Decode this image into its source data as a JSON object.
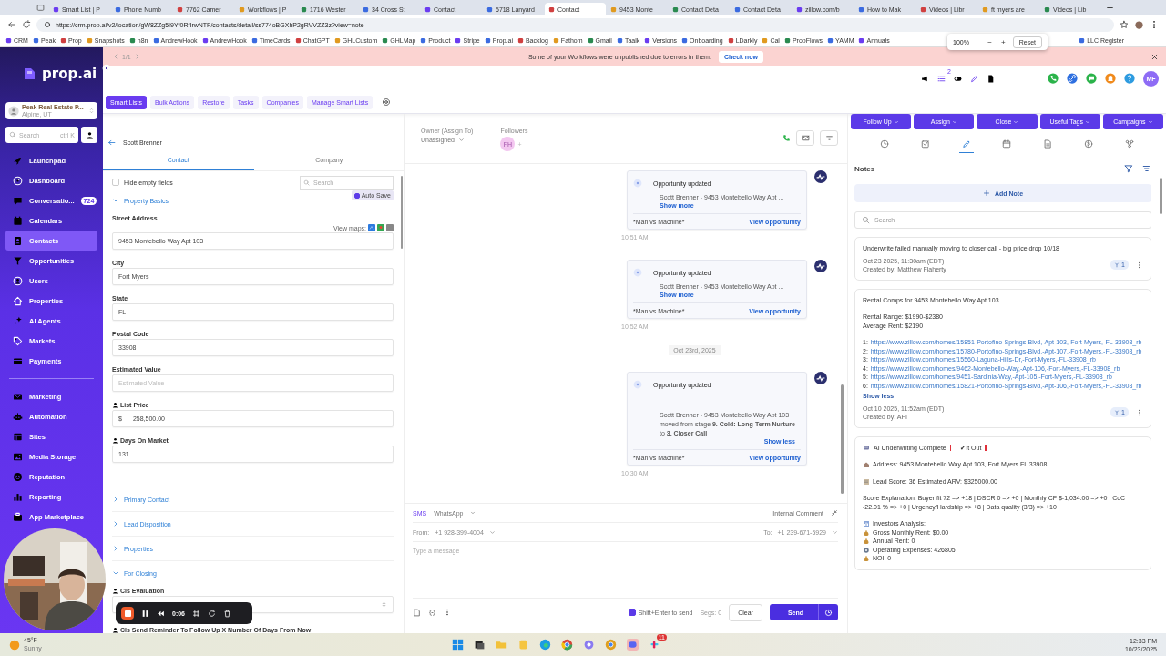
{
  "browser": {
    "tabs": [
      {
        "title": "Smart List | P",
        "selected": false
      },
      {
        "title": "Phone Numb",
        "selected": false
      },
      {
        "title": "7762 Camer",
        "selected": false
      },
      {
        "title": "Workflows | P",
        "selected": false
      },
      {
        "title": "1716 Wester",
        "selected": false
      },
      {
        "title": "34 Cross St",
        "selected": false
      },
      {
        "title": "Contact",
        "selected": false
      },
      {
        "title": "5718 Lanyard",
        "selected": false
      },
      {
        "title": "Contact",
        "selected": true
      },
      {
        "title": "9453 Monte",
        "selected": false
      },
      {
        "title": "Contact Deta",
        "selected": false
      },
      {
        "title": "Contact Deta",
        "selected": false
      },
      {
        "title": "zillow.com/b",
        "selected": false
      },
      {
        "title": "How to Mak",
        "selected": false
      },
      {
        "title": "Videos | Libr",
        "selected": false
      },
      {
        "title": "ft myers are",
        "selected": false
      },
      {
        "title": "Videos | Lib",
        "selected": false
      }
    ],
    "url": "https://crm.prop.ai/v2/location/gW8ZZg5I9Yf0RfIrwNTF/contacts/detail/ss774oBGXhP2gRVVZZ3z?view=note",
    "bookmarks": [
      "CRM",
      "Peak",
      "Prop",
      "Snapshots",
      "n8n",
      "AndrewHook",
      "AndrewHook",
      "TimeCards",
      "ChatGPT",
      "GHLCustom",
      "GHLMap",
      "Product",
      "Stripe",
      "Prop.ai",
      "Backlog",
      "Fathom",
      "Gmail",
      "Taalk",
      "Versions",
      "Onboarding",
      "LDarkly",
      "Cal",
      "PropFlows",
      "YAMM",
      "Annuals",
      "LLC Register"
    ],
    "zoom": {
      "value": "100%",
      "minus": "−",
      "plus": "+",
      "reset": "Reset"
    }
  },
  "banner": {
    "pager": "1/1",
    "message": "Some of your Workflows were unpublished due to errors in them.",
    "action": "Check now"
  },
  "header": {
    "badge": "2",
    "avatar": "MF"
  },
  "sidebar": {
    "logo": "prop.ai",
    "account": {
      "name": "Peak Real Estate P...",
      "location": "Alpine, UT"
    },
    "search": {
      "placeholder": "Search",
      "shortcut": "ctrl K"
    },
    "groups": [
      [
        {
          "label": "Launchpad",
          "selected": false
        },
        {
          "label": "Dashboard",
          "selected": false
        },
        {
          "label": "Conversatio...",
          "badge": "724",
          "selected": false
        },
        {
          "label": "Calendars",
          "selected": false
        },
        {
          "label": "Contacts",
          "selected": true
        },
        {
          "label": "Opportunities",
          "selected": false
        },
        {
          "label": "Users",
          "selected": false
        },
        {
          "label": "Properties",
          "selected": false
        },
        {
          "label": "AI Agents",
          "selected": false
        },
        {
          "label": "Markets",
          "selected": false
        },
        {
          "label": "Payments",
          "selected": false
        }
      ],
      [
        {
          "label": "Marketing",
          "selected": false
        },
        {
          "label": "Automation",
          "selected": false
        },
        {
          "label": "Sites",
          "selected": false
        },
        {
          "label": "Media Storage",
          "selected": false
        },
        {
          "label": "Reputation",
          "selected": false
        },
        {
          "label": "Reporting",
          "selected": false
        },
        {
          "label": "App Marketplace",
          "selected": false
        }
      ]
    ]
  },
  "toolbar": {
    "tabs": [
      {
        "label": "Smart Lists",
        "selected": true
      },
      {
        "label": "Bulk Actions",
        "selected": false
      },
      {
        "label": "Restore",
        "selected": false
      },
      {
        "label": "Tasks",
        "selected": false
      },
      {
        "label": "Companies",
        "selected": false
      },
      {
        "label": "Manage Smart Lists",
        "selected": false
      }
    ]
  },
  "contact": {
    "name": "Scott Brenner",
    "tabs": [
      {
        "label": "Contact",
        "selected": true
      },
      {
        "label": "Company",
        "selected": false
      }
    ],
    "hide_empty": {
      "label": "Hide empty fields",
      "checked": false
    },
    "search": {
      "placeholder": "Search"
    },
    "auto_save": {
      "label": "Auto Save",
      "checked": true
    },
    "sections": [
      {
        "title": "Property Basics",
        "expanded": true,
        "fields": [
          {
            "kind": "input",
            "label": "Street Address",
            "value": "9453 Montebello Way Apt 103",
            "maps_label": "View maps:",
            "custom": false
          },
          {
            "kind": "input",
            "label": "City",
            "value": "Fort Myers",
            "custom": false
          },
          {
            "kind": "input",
            "label": "State",
            "value": "FL",
            "custom": false
          },
          {
            "kind": "input",
            "label": "Postal Code",
            "value": "33908",
            "custom": false
          },
          {
            "kind": "input",
            "label": "Estimated Value",
            "placeholder": "Estimated Value",
            "custom": false
          },
          {
            "kind": "input",
            "label": "List Price",
            "prefix": "$",
            "value": "258,500.00",
            "custom": true
          },
          {
            "kind": "input",
            "label": "Days On Market",
            "value": "131",
            "custom": true
          }
        ]
      },
      {
        "title": "Primary Contact",
        "expanded": false
      },
      {
        "title": "Lead Disposition",
        "expanded": false
      },
      {
        "title": "Properties",
        "expanded": false
      },
      {
        "title": "For Closing",
        "expanded": true,
        "fields": [
          {
            "kind": "select",
            "label": "Cls Evaluation",
            "custom": true
          },
          {
            "kind": "heading",
            "label": "Cls Send Reminder To Follow Up X Number Of Days From Now",
            "custom": true
          }
        ]
      }
    ]
  },
  "conversation": {
    "owner_label": "Owner (Assign To)",
    "owner_value": "Unassigned",
    "followers_label": "Followers",
    "follower": "FH",
    "add_follower": "+",
    "messages": [
      {
        "kind": "card",
        "title": "Opportunity updated",
        "body": "Scott Brenner - 9453 Montebello Way Apt ...",
        "toggle": "Show more",
        "footer": "*Man vs Machine*",
        "action": "View opportunity",
        "time": "10:51 AM"
      },
      {
        "kind": "card",
        "title": "Opportunity updated",
        "body": "Scott Brenner - 9453 Montebello Way Apt ...",
        "toggle": "Show more",
        "footer": "*Man vs Machine*",
        "action": "View opportunity",
        "time": "10:52 AM"
      },
      {
        "kind": "date",
        "text": "Oct 23rd, 2025"
      },
      {
        "kind": "card",
        "title": "Opportunity updated",
        "body": "Scott Brenner - 9453 Montebello Way Apt 103 moved from stage **9. Cold: Long-Term Nurture** to **3. Closer Call**",
        "toggle": "Show less",
        "footer": "*Man vs Machine*",
        "action": "View opportunity",
        "time": "10:30 AM"
      }
    ],
    "composer": {
      "channels": [
        {
          "label": "SMS",
          "selected": true
        },
        {
          "label": "WhatsApp",
          "selected": false
        }
      ],
      "internal": "Internal Comment",
      "from_label": "From:",
      "from": "+1 928-399-4004",
      "to_label": "To:",
      "to": "+1 239-671-5929",
      "placeholder": "Type a message",
      "shift_enter": {
        "label": "Shift+Enter to send",
        "checked": true
      },
      "segs": "Segs: 0",
      "clear": "Clear",
      "send": "Send"
    }
  },
  "notes": {
    "actions": [
      "Follow Up",
      "Assign",
      "Close",
      "Useful Tags",
      "Campaigns"
    ],
    "tabs": [
      {
        "selected": false
      },
      {
        "selected": false
      },
      {
        "selected": true
      },
      {
        "selected": false
      },
      {
        "selected": false
      },
      {
        "selected": false
      },
      {
        "selected": false
      }
    ],
    "title": "Notes",
    "add": "Add Note",
    "search_placeholder": "Search",
    "items": [
      {
        "lines": [
          {
            "kind": "text",
            "text": "Underwrite failed manually moving to closer call - big price drop 10/18"
          }
        ],
        "date": "Oct 23 2025, 11:30am (EDT)",
        "author": "Created by: Matthew Flaherty",
        "count": "1"
      },
      {
        "lines": [
          {
            "kind": "text",
            "text": "Rental Comps for 9453 Montebello Way Apt 103"
          },
          {
            "kind": "gap"
          },
          {
            "kind": "text",
            "text": "Rental Range: $1990-$2380"
          },
          {
            "kind": "text",
            "text": "Average Rent: $2190"
          },
          {
            "kind": "gap"
          },
          {
            "kind": "link",
            "prefix": "1:",
            "url": "https://www.zillow.com/homes/15851-Portofino-Springs-Blvd,-Apt-103,-Fort-Myers,-FL-33908_rb"
          },
          {
            "kind": "link",
            "prefix": "2:",
            "url": "https://www.zillow.com/homes/15780-Portofino-Springs-Blvd,-Apt-107,-Fort-Myers,-FL-33908_rb"
          },
          {
            "kind": "link",
            "prefix": "3:",
            "url": "https://www.zillow.com/homes/15560-Laguna-Hills-Dr,-Fort-Myers,-FL-33908_rb"
          },
          {
            "kind": "link",
            "prefix": "4:",
            "url": "https://www.zillow.com/homes/9462-Montebello-Way,-Apt-106,-Fort-Myers,-FL-33908_rb"
          },
          {
            "kind": "link",
            "prefix": "5:",
            "url": "https://www.zillow.com/homes/9451-Sardinia-Way,-Apt-105,-Fort-Myers,-FL-33908_rb"
          },
          {
            "kind": "link",
            "prefix": "6:",
            "url": "https://www.zillow.com/homes/15821-Portofino-Springs-Blvd,-Apt-106,-Fort-Myers,-FL-33908_rb"
          }
        ],
        "toggle": "Show less",
        "date": "Oct 10 2025, 11:52am (EDT)",
        "author": "Created by: API",
        "count": "1"
      },
      {
        "lines": [
          {
            "kind": "status",
            "text": "AI Underwriting Complete",
            "tag": "✔It Out"
          },
          {
            "kind": "gap"
          },
          {
            "kind": "icon_text",
            "text": "Address: 9453 Montebello Way Apt 103, Fort Myers FL 33908"
          },
          {
            "kind": "gap"
          },
          {
            "kind": "icon_text",
            "text": "Lead Score: 36  Estimated ARV: $325000.00"
          },
          {
            "kind": "gap"
          },
          {
            "kind": "text",
            "text": "Score Explanation: Buyer fit 72 => +18 | DSCR 0 => +0 | Monthly CF $-1,034.00 => +0 | CoC -22.01 % => +0 | Urgency/Hardship => +8 | Data quality (3/3) => +10"
          },
          {
            "kind": "gap"
          },
          {
            "kind": "icon_text",
            "text": "Investors Analysis:"
          },
          {
            "kind": "icon_text",
            "text": "Gross Monthly Rent: $0.00"
          },
          {
            "kind": "icon_text",
            "text": "Annual Rent: 0"
          },
          {
            "kind": "icon_text",
            "text": "Operating Expenses: 426805"
          },
          {
            "kind": "icon_text",
            "text": "NOI: 0"
          }
        ]
      }
    ]
  },
  "recorder": {
    "time": "0:06"
  },
  "taskbar": {
    "temp": "45°F",
    "condition": "Sunny",
    "badge": "11",
    "time": "12:33 PM",
    "date": "10/23/2025"
  }
}
